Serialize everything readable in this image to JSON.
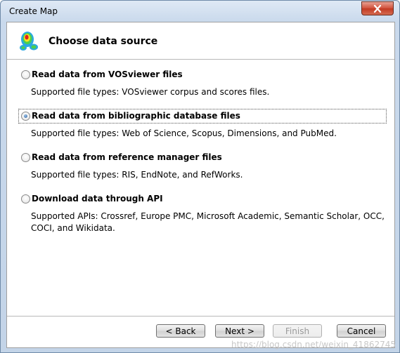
{
  "window": {
    "title": "Create Map"
  },
  "header": {
    "title": "Choose data source",
    "icon": "vosviewer-density-icon"
  },
  "options": [
    {
      "label": "Read data from VOSviewer files",
      "description": "Supported file types: VOSviewer corpus and scores files.",
      "selected": false
    },
    {
      "label": "Read data from bibliographic database files",
      "description": "Supported file types: Web of Science, Scopus, Dimensions, and PubMed.",
      "selected": true
    },
    {
      "label": "Read data from reference manager files",
      "description": "Supported file types: RIS, EndNote, and RefWorks.",
      "selected": false
    },
    {
      "label": "Download data through API",
      "description": "Supported APIs: Crossref, Europe PMC, Microsoft Academic, Semantic Scholar, OCC, COCI, and Wikidata.",
      "selected": false
    }
  ],
  "buttons": {
    "back": "< Back",
    "next": "Next >",
    "finish": "Finish",
    "cancel": "Cancel"
  },
  "colors": {
    "titlebar": "#c9d9ec",
    "close": "#c23a22",
    "radio_selected": "#2b5e9a"
  },
  "watermark": "https://blog.csdn.net/weixin_41862745"
}
